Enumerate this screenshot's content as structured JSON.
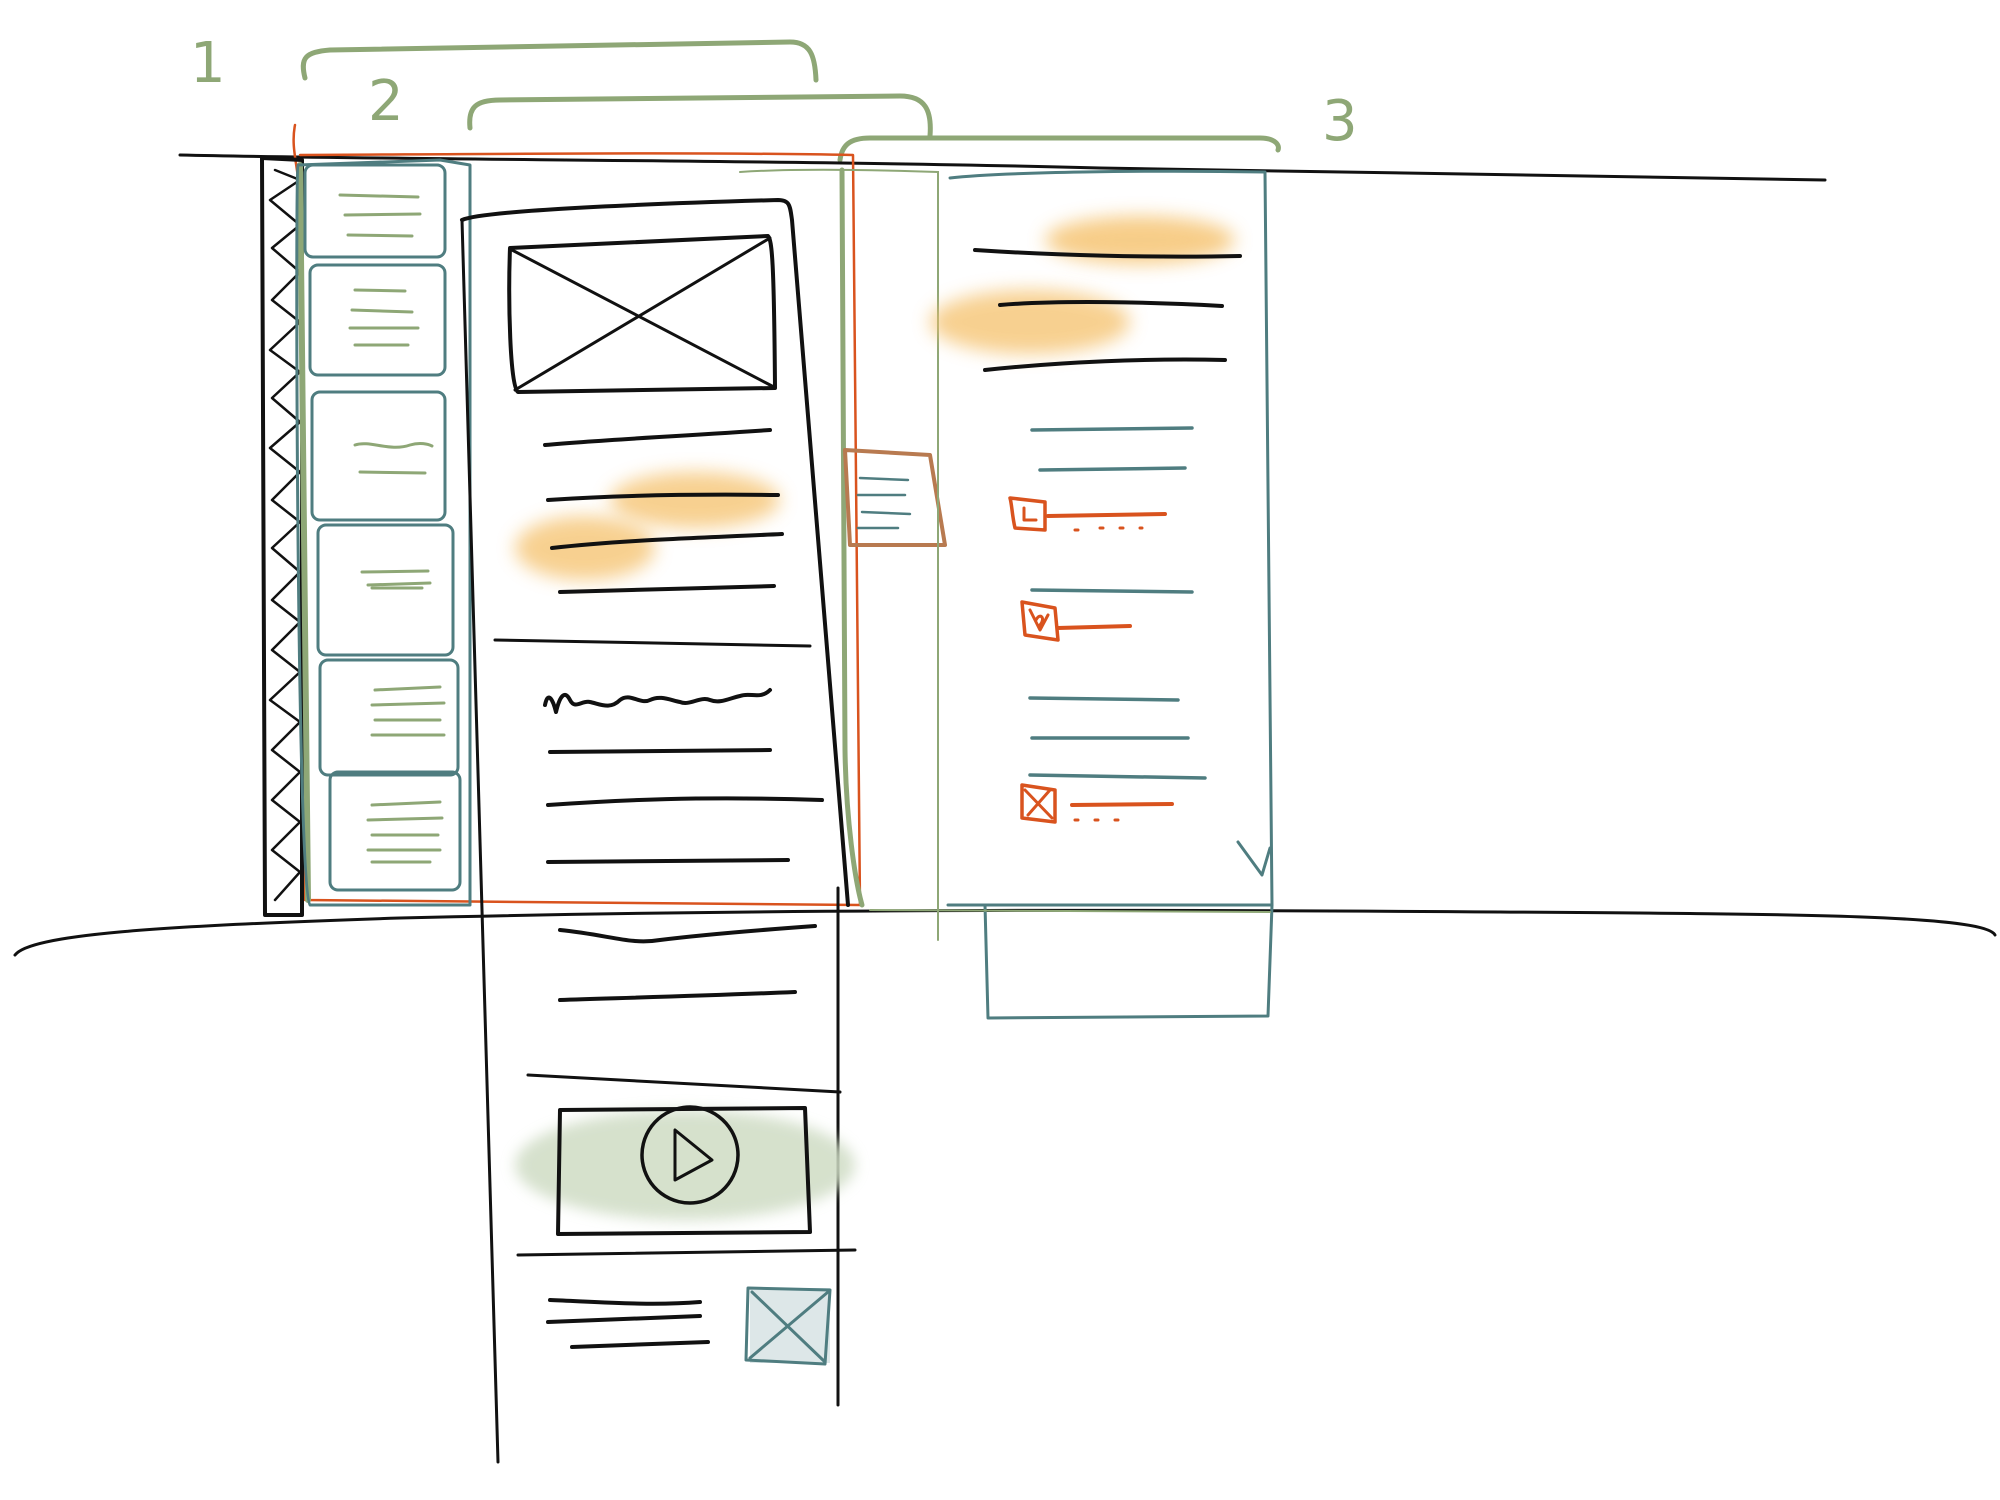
{
  "colors": {
    "ink": "#111111",
    "teal": "#4f7d80",
    "green": "#8ea776",
    "orange": "#d9531e",
    "brown": "#b87a50",
    "highlight": "#f5c16c",
    "video_wash": "#cfdcc4"
  },
  "sketch": {
    "column_labels": [
      "1",
      "2",
      "3"
    ],
    "icons": [
      "image-placeholder-icon",
      "play-icon",
      "checkbox-icon",
      "thumbnail-placeholder-icon"
    ]
  }
}
